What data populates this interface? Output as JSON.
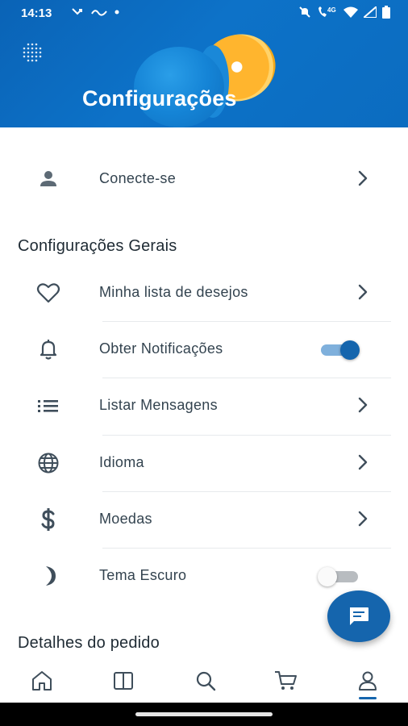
{
  "status_bar": {
    "time": "14:13",
    "left_icons": [
      "missed-call-icon",
      "carrier-icon",
      "dot-icon"
    ],
    "right_icons": [
      "mute-icon",
      "wifi-calling-icon",
      "wifi-icon",
      "signal-icon",
      "battery-icon"
    ],
    "network_label": "4G"
  },
  "header": {
    "title": "Configurações",
    "logo_icon": "dots-grid-icon"
  },
  "account_row": {
    "icon": "person-icon",
    "label": "Conecte-se"
  },
  "general_section": {
    "title": "Configurações Gerais",
    "items": [
      {
        "icon": "heart-icon",
        "label": "Minha lista de desejos",
        "type": "link"
      },
      {
        "icon": "bell-icon",
        "label": "Obter Notificações",
        "type": "toggle",
        "on": true
      },
      {
        "icon": "list-icon",
        "label": "Listar Mensagens",
        "type": "link"
      },
      {
        "icon": "globe-icon",
        "label": "Idioma",
        "type": "link"
      },
      {
        "icon": "dollar-icon",
        "label": "Moedas",
        "type": "link"
      },
      {
        "icon": "moon-icon",
        "label": "Tema Escuro",
        "type": "toggle",
        "on": false
      }
    ]
  },
  "order_section": {
    "title": "Detalhes do pedido"
  },
  "fab": {
    "icon": "chat-icon"
  },
  "bottom_nav": {
    "items": [
      {
        "icon": "home-icon",
        "active": false
      },
      {
        "icon": "book-icon",
        "active": false
      },
      {
        "icon": "search-icon",
        "active": false
      },
      {
        "icon": "cart-icon",
        "active": false
      },
      {
        "icon": "profile-icon",
        "active": true
      }
    ]
  },
  "colors": {
    "header_blue": "#0b6cc0",
    "accent": "#1565ad",
    "toggle_on_track": "#7fb0dc",
    "toggle_off_track": "#b8bcc0",
    "icon": "#4a5a68"
  }
}
